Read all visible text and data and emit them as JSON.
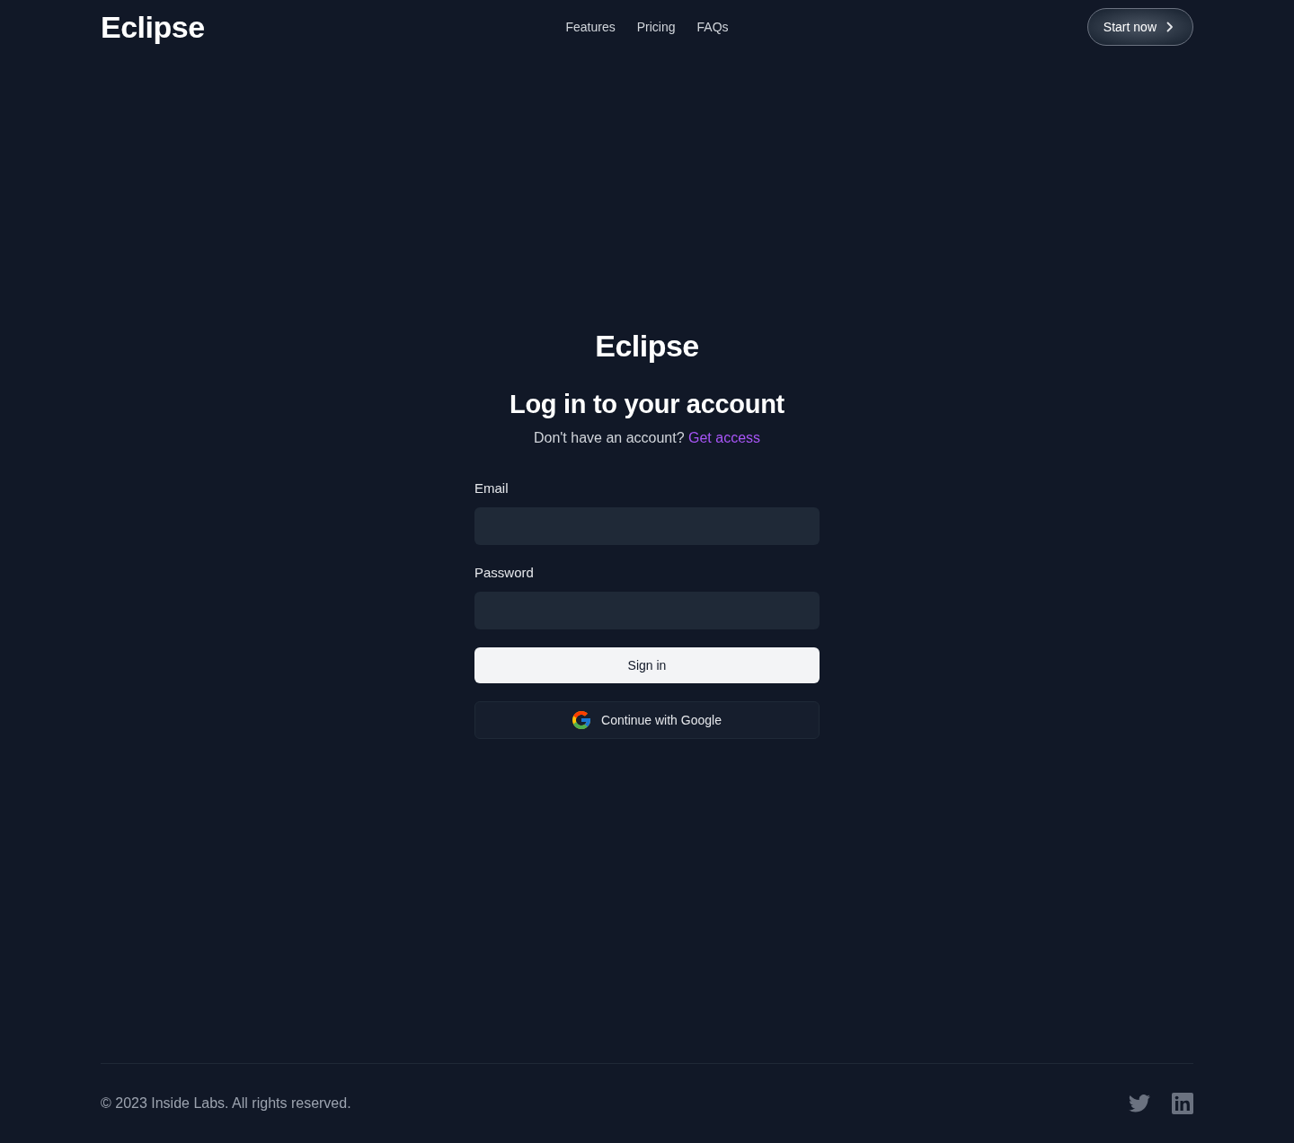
{
  "header": {
    "logo": "Eclipse",
    "nav": [
      {
        "label": "Features"
      },
      {
        "label": "Pricing"
      },
      {
        "label": "FAQs"
      }
    ],
    "cta": {
      "label": "Start now"
    }
  },
  "login": {
    "brand": "Eclipse",
    "title": "Log in to your account",
    "prompt": "Don't have an account?",
    "link": "Get access",
    "fields": [
      {
        "label": "Email"
      },
      {
        "label": "Password"
      }
    ],
    "submit": "Sign in",
    "google": "Continue with Google"
  },
  "footer": {
    "copyright": "© 2023 Inside Labs. All rights reserved."
  }
}
